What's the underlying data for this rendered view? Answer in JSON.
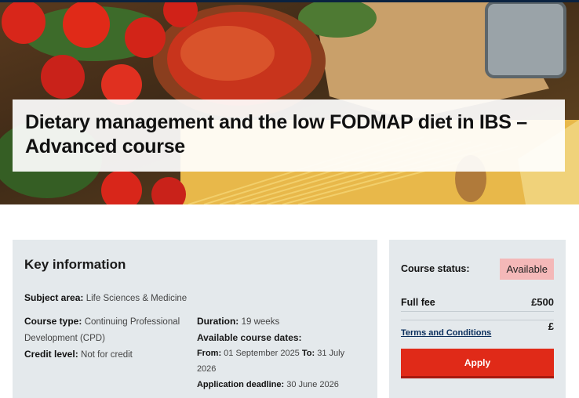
{
  "hero": {
    "title": "Dietary management and the low FODMAP diet in IBS – Advanced course"
  },
  "key_info": {
    "heading": "Key information",
    "subject_area_label": "Subject area:",
    "subject_area_value": "Life Sciences & Medicine",
    "course_type_label": "Course type:",
    "course_type_value": "Continuing Professional Development (CPD)",
    "credit_level_label": "Credit level:",
    "credit_level_value": "Not for credit",
    "duration_label": "Duration:",
    "duration_value": "19 weeks",
    "dates_heading": "Available course dates:",
    "from_label": "From:",
    "from_value": "01 September 2025",
    "to_label": "To:",
    "to_value": "31 July 2026",
    "deadline_label": "Application deadline:",
    "deadline_value": "30 June 2026"
  },
  "status": {
    "status_label": "Course status:",
    "status_value": "Available",
    "fee_label": "Full fee",
    "fee_value": "£500",
    "terms_link": "Terms and Conditions",
    "terms_value": "£",
    "apply_label": "Apply"
  },
  "colors": {
    "accent_red": "#e02a18",
    "badge_pink": "#f4b8b8",
    "panel_grey": "#e4e9ec",
    "link_navy": "#0a2e5c"
  }
}
